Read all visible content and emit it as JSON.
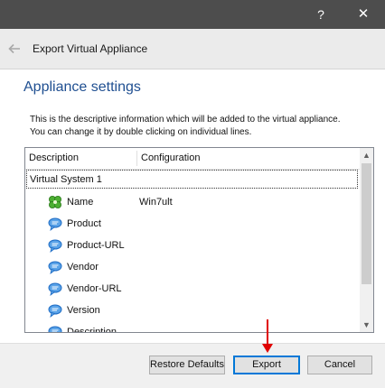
{
  "window": {
    "help_label": "?",
    "close_label": "✕"
  },
  "header": {
    "title": "Export Virtual Appliance",
    "back_icon": "arrow-left-icon"
  },
  "section": {
    "title": "Appliance settings",
    "description_line1": "This is the descriptive information which will be added to the virtual appliance.",
    "description_line2": "You can change it by double clicking on individual lines."
  },
  "tree": {
    "columns": [
      "Description",
      "Configuration"
    ],
    "system_label": "Virtual System 1",
    "rows": [
      {
        "label": "Name",
        "value": "Win7ult",
        "icon": "name-icon"
      },
      {
        "label": "Product",
        "value": "",
        "icon": "speech-bubble-icon"
      },
      {
        "label": "Product-URL",
        "value": "",
        "icon": "speech-bubble-icon"
      },
      {
        "label": "Vendor",
        "value": "",
        "icon": "speech-bubble-icon"
      },
      {
        "label": "Vendor-URL",
        "value": "",
        "icon": "speech-bubble-icon"
      },
      {
        "label": "Version",
        "value": "",
        "icon": "speech-bubble-icon"
      },
      {
        "label": "Description",
        "value": "",
        "icon": "speech-bubble-icon"
      }
    ]
  },
  "buttons": {
    "restore": "Restore Defaults",
    "export": "Export",
    "cancel": "Cancel"
  },
  "colors": {
    "titlebar": "#4d4d4d",
    "accent": "#1f4f91",
    "annotation_arrow": "#e00000"
  }
}
